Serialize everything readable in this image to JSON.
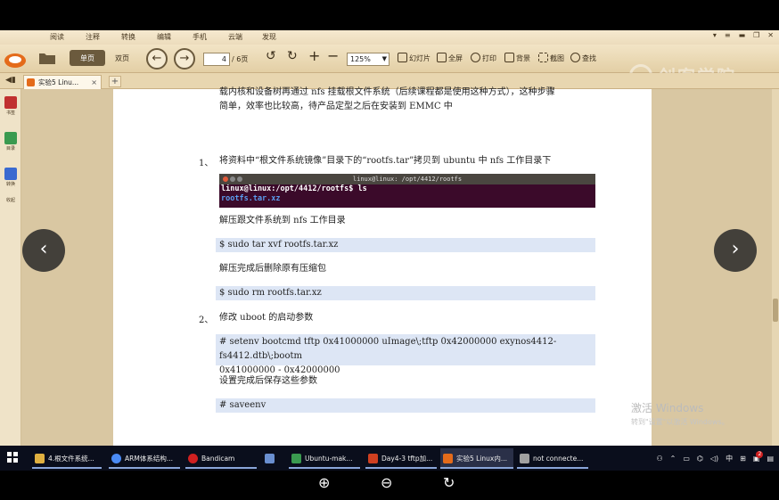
{
  "menu": [
    "阅读",
    "注释",
    "转换",
    "编辑",
    "手机",
    "云端",
    "发现"
  ],
  "toolbar": {
    "single_page": "单页",
    "double_page": "双页",
    "page_current": "4",
    "page_total": "/ 6页",
    "zoom": "125%",
    "slideshow": "幻灯片",
    "fullscreen": "全屏",
    "print": "打印",
    "background": "背景",
    "screenshot": "截图",
    "search": "查找"
  },
  "brand": "创客学院",
  "tab": {
    "title": "实验5 Linu...",
    "new": "+"
  },
  "sidebar": [
    "书签",
    "目录",
    "转换",
    "收起"
  ],
  "doc": {
    "line_top": "载内核和设备树再通过 nfs 挂载根文件系统（后续课程都是使用这种方式），这种步骤",
    "line_2": "简单，效率也比较高，待产品定型之后在安装到 EMMC 中",
    "step1_num": "1、",
    "step1_text": "将资料中“根文件系统镜像”目录下的“rootfs.tar”拷贝到 ubuntu 中 nfs 工作目录下",
    "terminal_title": "linux@linux: /opt/4412/rootfs",
    "terminal_cmd": "linux@linux:/opt/4412/rootfs$ ls",
    "terminal_out": "rootfs.tar.xz",
    "extract_text": "解压跟文件系统到 nfs 工作目录",
    "cmd_extract": "$ sudo    tar    xvf    rootfs.tar.xz",
    "delete_text": "解压完成后删除原有压缩包",
    "cmd_delete": "$ sudo    rm    rootfs.tar.xz",
    "step2_num": "2、",
    "step2_text": "修改 uboot 的启动参数",
    "cmd_setenv_1": "# setenv bootcmd tftp 0x41000000 uImage\\;tftp 0x42000000 exynos4412-fs4412.dtb\\;bootm",
    "cmd_setenv_2": "0x41000000 - 0x42000000",
    "save_text": "设置完成后保存这些参数",
    "cmd_save": "# saveenv"
  },
  "activation": {
    "line1": "激活 Windows",
    "line2": "转到\"设置\"以激活 Windows。"
  },
  "nav": {
    "prev": "‹",
    "next": "›"
  },
  "taskbar": [
    {
      "label": "4.根文件系统...",
      "color": "#e0b040"
    },
    {
      "label": "ARM体系结构...",
      "color": "#4a8af4"
    },
    {
      "label": "Bandicam",
      "color": "#d02020"
    },
    {
      "label": "",
      "color": "#6a8fd0"
    },
    {
      "label": "Ubuntu-mak...",
      "color": "#3a9a50"
    },
    {
      "label": "Day4-3 tftp加...",
      "color": "#d04020"
    },
    {
      "label": "实验5 Linux内...",
      "color": "#e46b1a"
    },
    {
      "label": "not connecte...",
      "color": "#a0a0a0"
    }
  ],
  "tray": {
    "lang": "中",
    "badge": "2"
  },
  "bottom": {
    "zoom_in": "⊕",
    "zoom_out": "⊖",
    "rotate": "↻"
  }
}
